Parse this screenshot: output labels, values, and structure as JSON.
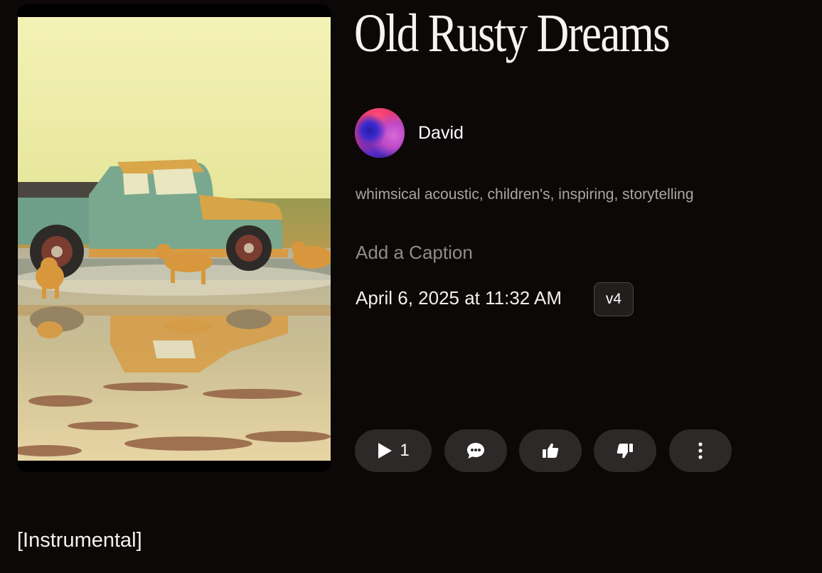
{
  "song": {
    "title": "Old Rusty Dreams",
    "creator": "David",
    "tags": "whimsical acoustic, children's, inspiring, storytelling",
    "caption_placeholder": "Add a Caption",
    "date": "April 6, 2025 at 11:32 AM",
    "version": "v4",
    "lyrics": "[Instrumental]"
  },
  "actions": {
    "play_count": "1",
    "play_icon": "play-icon",
    "comment_icon": "comment-icon",
    "like_icon": "thumbs-up-icon",
    "dislike_icon": "thumbs-down-icon",
    "more_icon": "more-vertical-icon"
  },
  "colors": {
    "background": "#0c0808",
    "button": "#2d2929",
    "muted_text": "#a9a6a4"
  }
}
